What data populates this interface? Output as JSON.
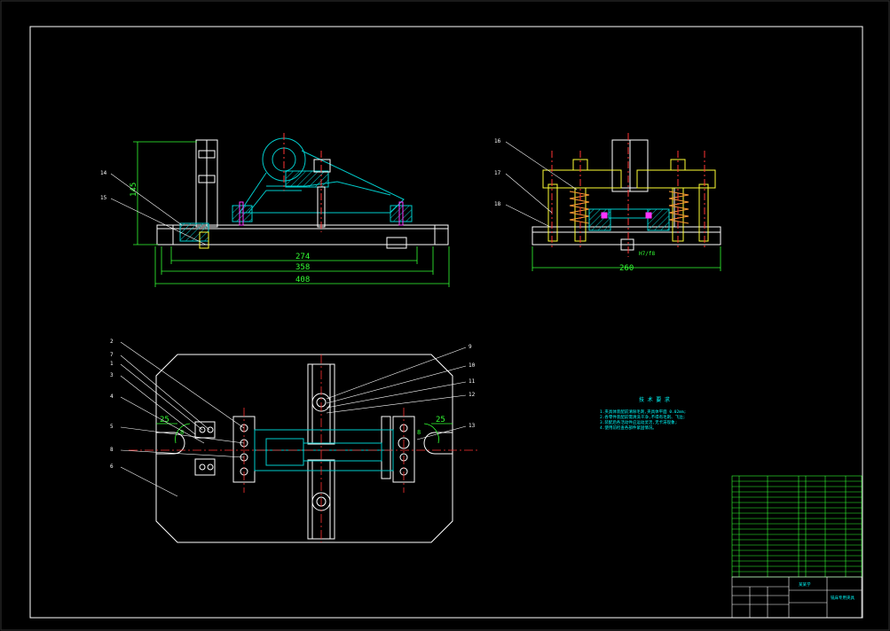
{
  "dimensions": {
    "front_height": "145",
    "front_w1": "274",
    "front_w2": "358",
    "front_w3": "408",
    "side_width": "260",
    "fit": "H7/f8",
    "plan_left": "25",
    "plan_right": "25",
    "plan_left_b": "8",
    "plan_right_b": "8"
  },
  "callouts": {
    "c1": "1",
    "c2": "2",
    "c3": "3",
    "c4": "4",
    "c5": "5",
    "c6": "6",
    "c7": "7",
    "c8": "8",
    "c9": "9",
    "c10": "10",
    "c11": "11",
    "c12": "12",
    "c13": "13",
    "c14": "14",
    "c15": "15",
    "c16": "16",
    "c17": "17",
    "c18": "18"
  },
  "notes": {
    "title": "技 术 要 求",
    "line1": "1.夹具体装配前清除毛刺,夹具体平面 0.02mm;",
    "line2": "2.各零件装配前需清洗干净,不得有毛刺、飞边;",
    "line3": "3.装配后各活动件应运动灵活,无卡滞现象;",
    "line4": "4.使用前检查各部件紧固情况。"
  },
  "title_block": {
    "drawing_title": "铣床专用夹具",
    "owner": "某某学"
  },
  "colors": {
    "frame": "#ffffff",
    "outline": "#ffffff",
    "section": "#00cccc",
    "centerline": "#ff3333",
    "dimension": "#33ff33",
    "accent": "#ffff33",
    "magenta": "#ff33ff"
  }
}
